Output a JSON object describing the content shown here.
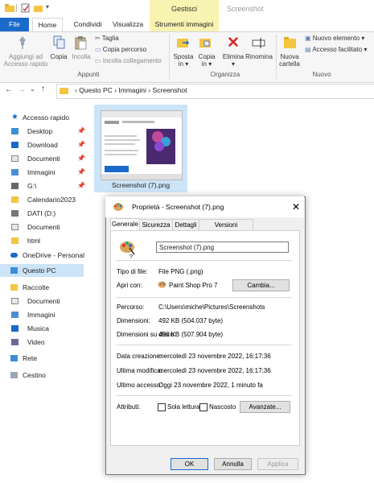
{
  "titlebar": {
    "contextual_group": "Gestisci",
    "window_title": "Screenshot"
  },
  "tabs": {
    "file": "File",
    "home": "Home",
    "condividi": "Condividi",
    "visualizza": "Visualizza",
    "strumenti": "Strumenti immagini"
  },
  "ribbon": {
    "appunti": {
      "pin": [
        "Aggiungi ad",
        "Accesso rapido"
      ],
      "copia": "Copia",
      "incolla": "Incolla",
      "taglia": "Taglia",
      "copia_percorso": "Copia percorso",
      "incolla_collegamento": "Incolla collegamento",
      "label": "Appunti"
    },
    "organizza": {
      "sposta": [
        "Sposta",
        "in"
      ],
      "copia_in": [
        "Copia",
        "in"
      ],
      "elimina": "Elimina",
      "rinomina": "Rinomina",
      "label": "Organizza"
    },
    "nuovo": {
      "nuova_cartella": [
        "Nuova",
        "cartella"
      ],
      "nuovo_elemento": "Nuovo elemento",
      "accesso_facilitato": "Accesso facilitato",
      "label": "Nuovo"
    }
  },
  "address": {
    "path": [
      "Questo PC",
      "Immagini",
      "Screenshot"
    ]
  },
  "nav": {
    "accesso_rapido": "Accesso rapido",
    "items_quick": [
      "Desktop",
      "Download",
      "Documenti",
      "Immagini",
      "G:\\",
      "Calendario2023",
      "DATI (D:)",
      "Documenti",
      "html"
    ],
    "onedrive": "OneDrive - Personal",
    "questo_pc": "Questo PC",
    "raccolte": "Raccolte",
    "items_raccolte": [
      "Documenti",
      "Immagini",
      "Musica",
      "Video"
    ],
    "rete": "Rete",
    "cestino": "Cestino"
  },
  "file": {
    "name": "Screenshot (7).png"
  },
  "dialog": {
    "title": "Proprietà - Screenshot (7).png",
    "tabs": [
      "Generale",
      "Sicurezza",
      "Dettagli",
      "Versioni precedenti"
    ],
    "filename": "Screenshot (7).png",
    "tipo_label": "Tipo di file:",
    "tipo_value": "File PNG (.png)",
    "apri_label": "Apri con:",
    "apri_value": "Paint Shop Pro 7",
    "cambia": "Cambia...",
    "percorso_label": "Percorso:",
    "percorso_value": "C:\\Users\\miche\\Pictures\\Screenshots",
    "dimensioni_label": "Dimensioni:",
    "dimensioni_value": "492 KB (504.037 byte)",
    "dimdisco_label": "Dimensioni su disco:",
    "dimdisco_value": "496 KB (507.904 byte)",
    "creazione_label": "Data creazione:",
    "creazione_value": "mercoledì 23 novembre 2022, 16:17:36",
    "modifica_label": "Ultima modifica:",
    "modifica_value": "mercoledì 23 novembre 2022, 16:17:36",
    "accesso_label": "Ultimo accesso:",
    "accesso_value": "Oggi 23 novembre 2022, 1 minuto fa",
    "attributi_label": "Attributi:",
    "sola_lettura": "Sola lettura",
    "nascosto": "Nascosto",
    "avanzate": "Avanzate...",
    "ok": "OK",
    "annulla": "Annulla",
    "applica": "Applica"
  }
}
